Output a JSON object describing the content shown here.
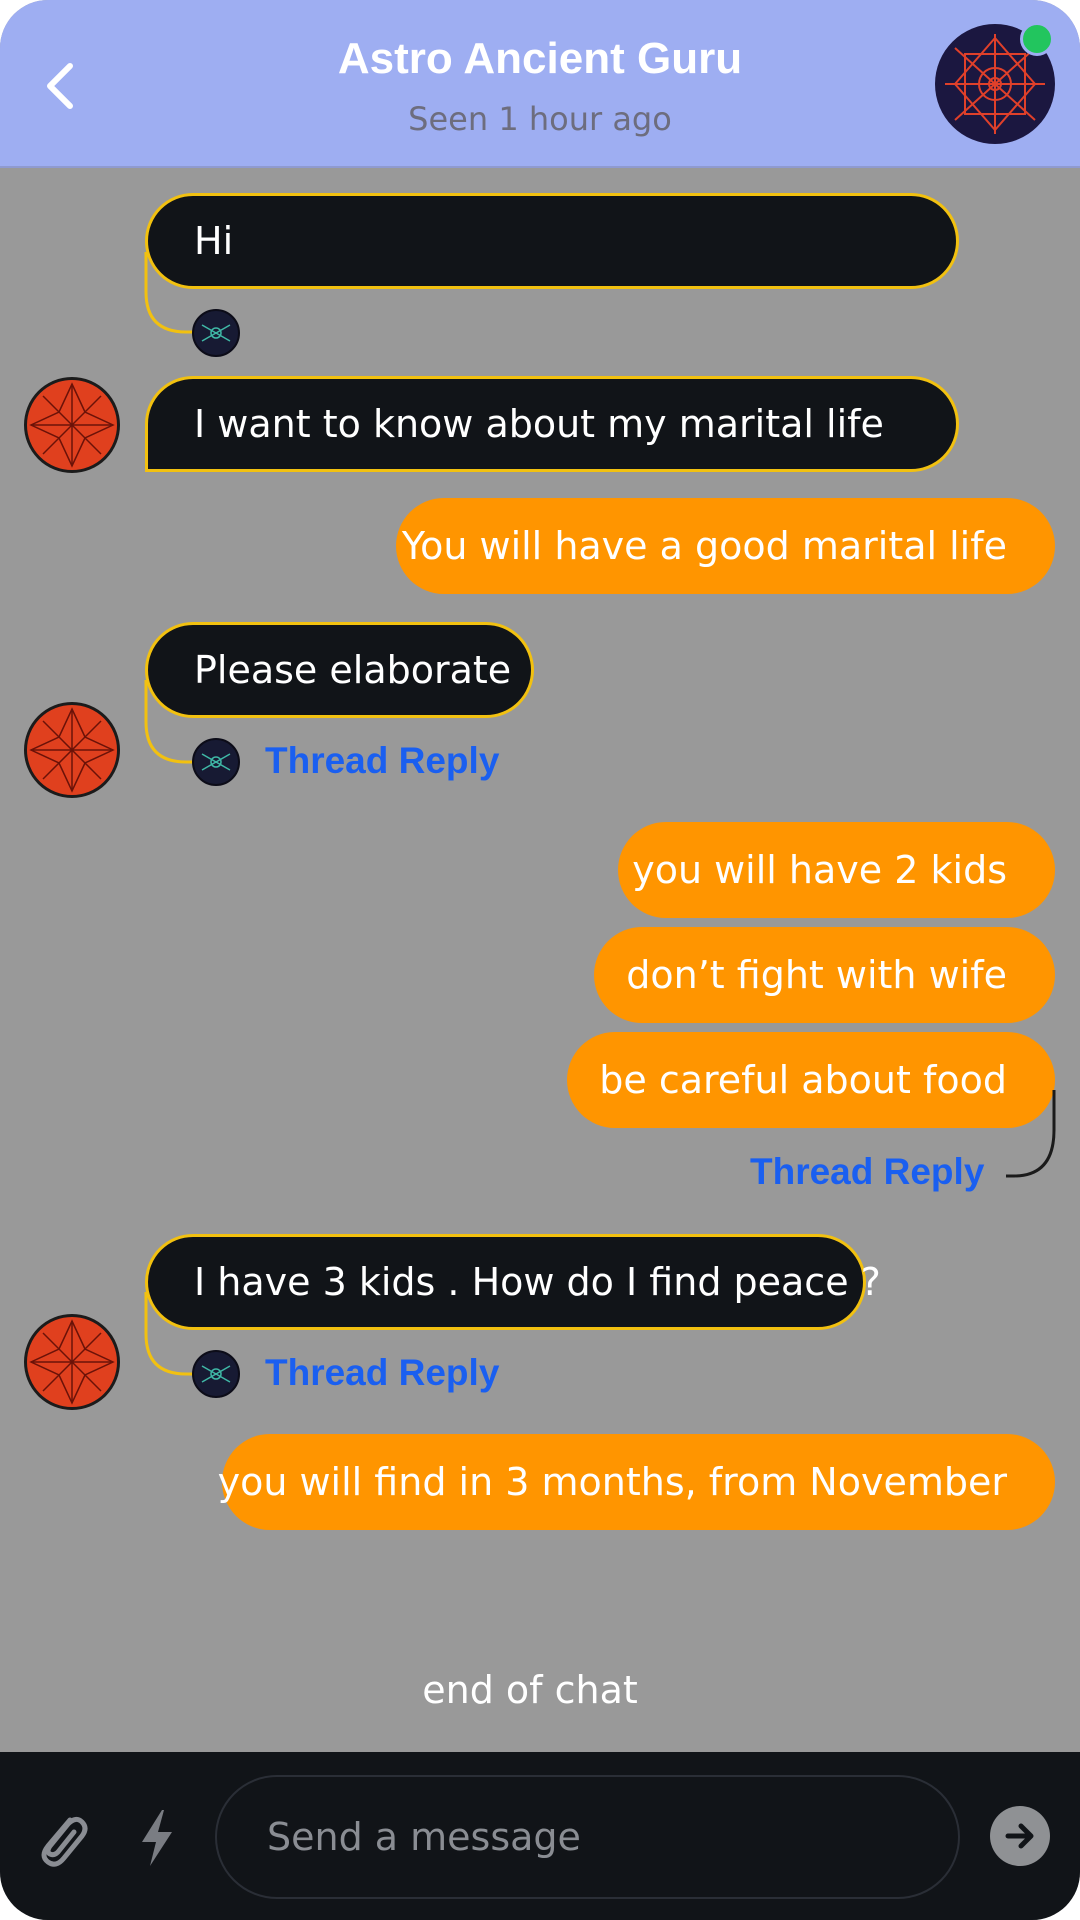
{
  "header": {
    "title": "Astro Ancient Guru",
    "status": "Seen 1 hour ago"
  },
  "messages": [
    {
      "text": "Hi"
    },
    {
      "text": "I want to know about my marital life"
    },
    {
      "text": "You will have a good marital life"
    },
    {
      "text": "Please elaborate"
    },
    {
      "text": "you will have 2 kids"
    },
    {
      "text": "don’t fight with wife"
    },
    {
      "text": "be careful about  food"
    },
    {
      "text": "I have 3 kids . How do I find peace ?"
    },
    {
      "text": "you will find in 3 months, from November"
    }
  ],
  "thread_reply_label": "Thread Reply",
  "end_of_chat": "end of chat",
  "composer": {
    "placeholder": "Send a message"
  },
  "colors": {
    "header_bg": "#9eaef2",
    "chat_bg": "#999999",
    "incoming_bubble": "#111418",
    "incoming_border": "#f2c110",
    "outgoing_bubble": "#ff9500",
    "link": "#1a5ff0",
    "online": "#22c55e"
  },
  "icons": [
    "back-arrow-icon",
    "guru-avatar",
    "online-status-dot",
    "user-avatar",
    "paperclip-icon",
    "lightning-icon",
    "send-arrow-icon"
  ]
}
